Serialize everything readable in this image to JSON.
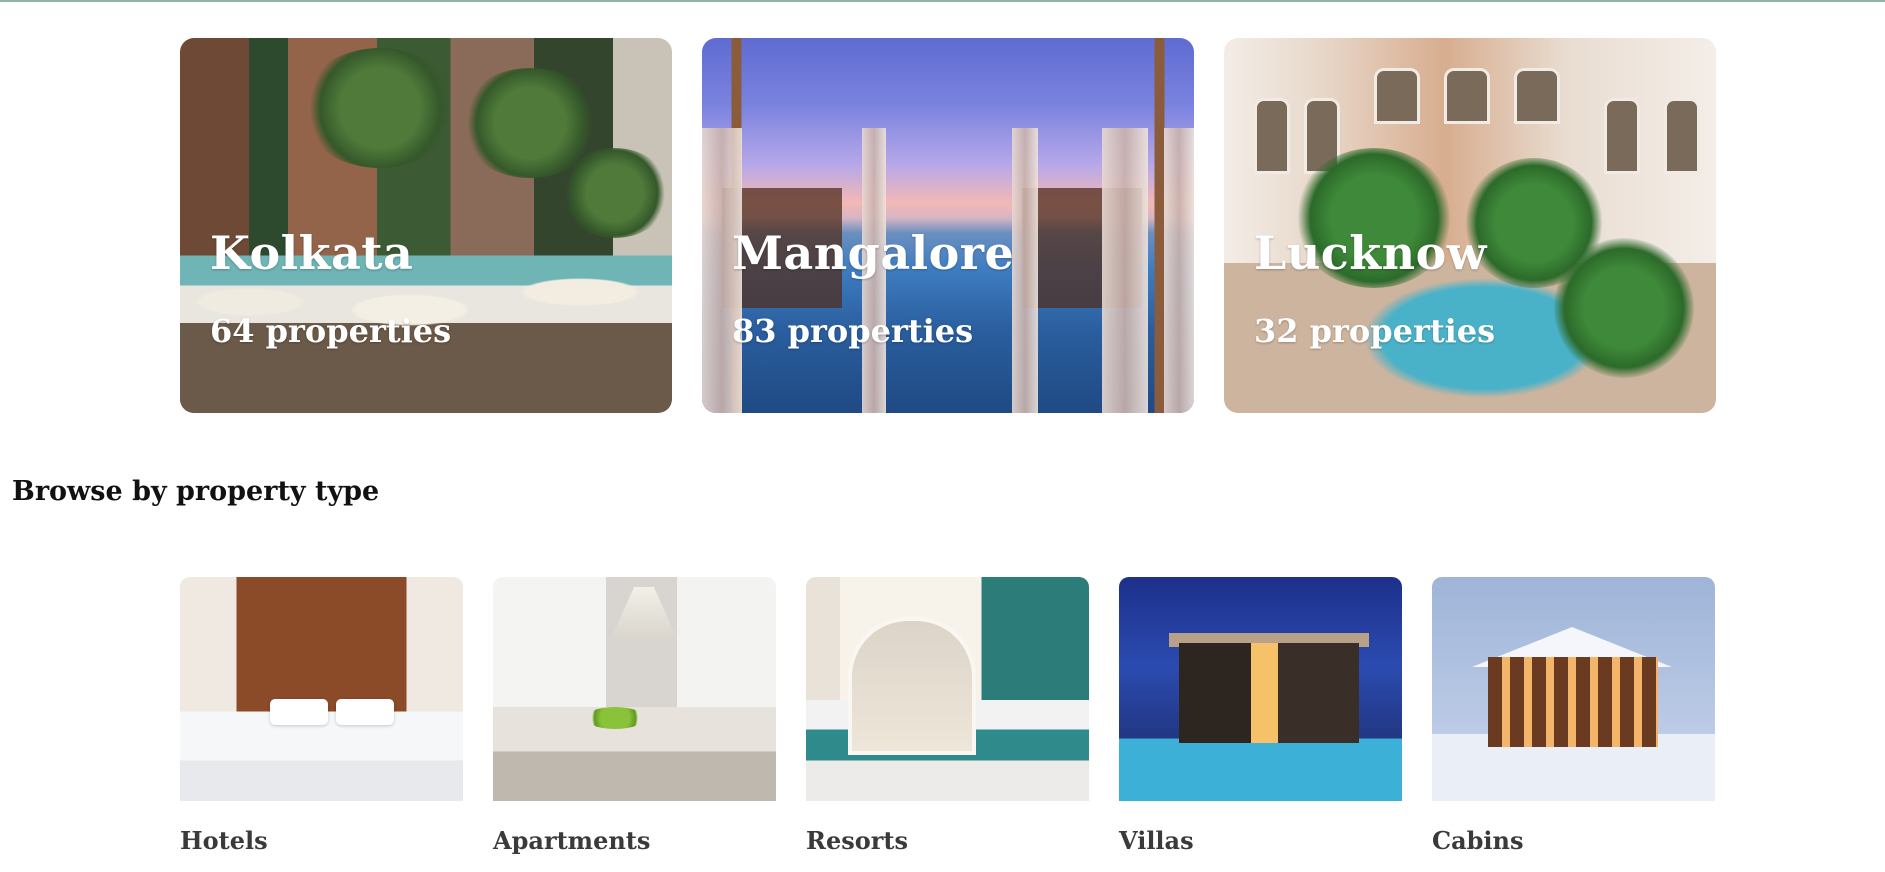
{
  "featured_cities": [
    {
      "name": "Kolkata",
      "properties": "64 properties"
    },
    {
      "name": "Mangalore",
      "properties": "83 properties"
    },
    {
      "name": "Lucknow",
      "properties": "32 properties"
    }
  ],
  "property_types": {
    "heading": "Browse by property type",
    "items": [
      {
        "label": "Hotels"
      },
      {
        "label": "Apartments"
      },
      {
        "label": "Resorts"
      },
      {
        "label": "Villas"
      },
      {
        "label": "Cabins"
      }
    ]
  }
}
